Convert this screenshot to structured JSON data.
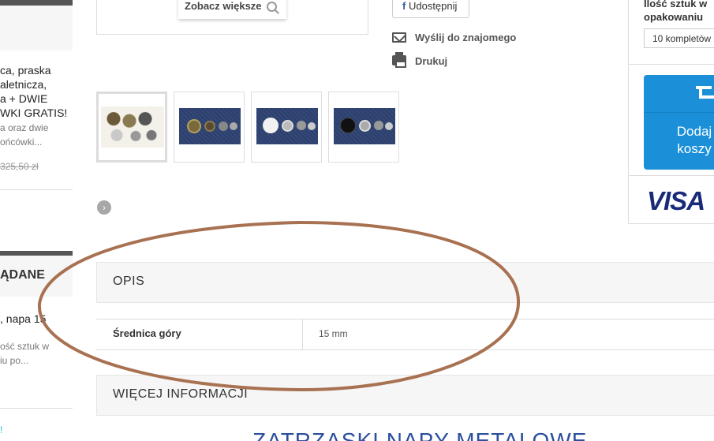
{
  "sidebar": {
    "promo_lines": [
      "ca, praska",
      "aletnicza,",
      "a + DWIE",
      "WKI GRATIS!"
    ],
    "promo_sub_lines": [
      "a oraz dwie",
      "ońcówki..."
    ],
    "old_price": "325,50 zł",
    "section_heading": "ĄDANE",
    "product_title": ", napa 15",
    "product_sub_lines": [
      "ość sztuk w",
      "iu po..."
    ],
    "marker": "!"
  },
  "gallery": {
    "zoom_label": "Zobacz większe",
    "nav_arrow": "›"
  },
  "actions": {
    "share_icon": "f",
    "share_label": "Udostępnij",
    "send_label": "Wyślij do znajomego",
    "print_label": "Drukuj"
  },
  "purchase": {
    "qty_label_line1": "Ilość sztuk w",
    "qty_label_line2": "opakowaniu",
    "qty_selected": "10 kompletów",
    "cart_line1": "Dodaj",
    "cart_line2": "koszy",
    "payment_logo": "VISA",
    "cart_color": "#1b8fd8"
  },
  "details": {
    "description_title": "OPIS",
    "feature_name": "Średnica góry",
    "feature_value": "15 mm",
    "more_info_title": "WIĘCEJ INFORMACJI"
  },
  "footer": {
    "related_title": "ZATRZASKI NAPY METALOWE"
  },
  "annotation_color": "#a87252"
}
